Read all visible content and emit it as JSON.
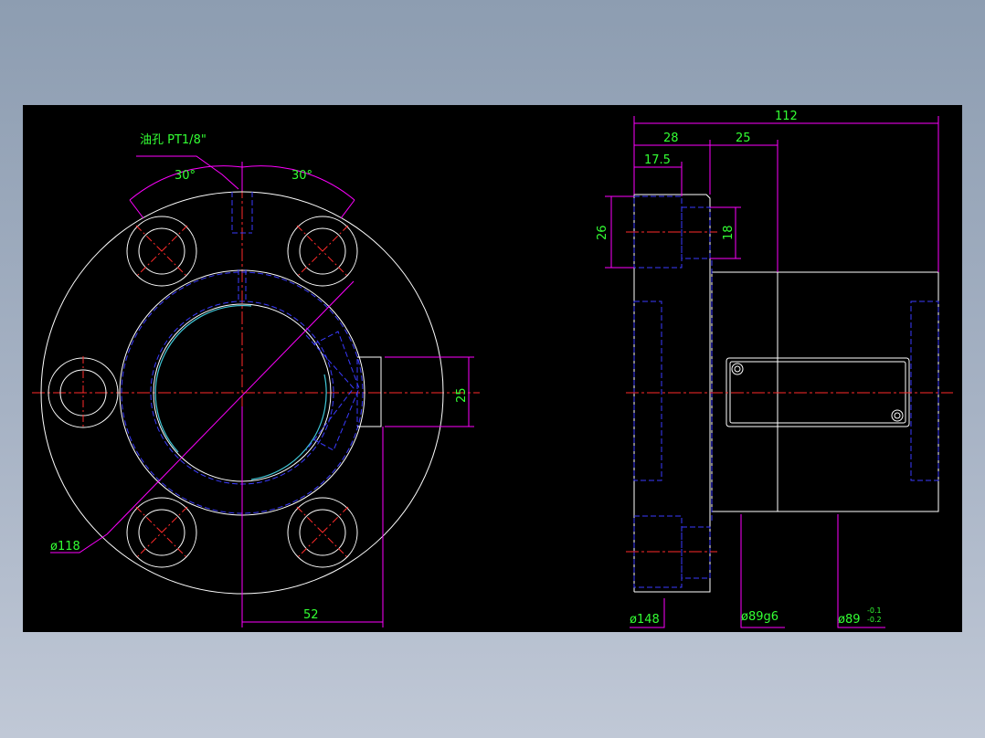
{
  "drawing": {
    "background": "#000000",
    "colors": {
      "outline": "#ffffff",
      "hidden": "#3a3aff",
      "center": "#ff2a2a",
      "dimension": "#ff00ff",
      "text": "#33ff33",
      "thread": "#40c8d8"
    },
    "front_view": {
      "note": "油孔 PT1/8\"",
      "angle_left": "30°",
      "angle_right": "30°",
      "dim_pcd": "ø118",
      "dim_height": "25",
      "dim_offset": "52"
    },
    "side_view": {
      "dim_total": "112",
      "dim_flange": "28",
      "dim_body": "25",
      "dim_hole_depth": "17.5",
      "dim_counterbore": "26",
      "dim_hole": "18",
      "dia_flange": "ø148",
      "dia_body": "ø89g6",
      "dia_relief_base": "ø89",
      "tol_upper": "-0.1",
      "tol_lower": "-0.2"
    }
  }
}
